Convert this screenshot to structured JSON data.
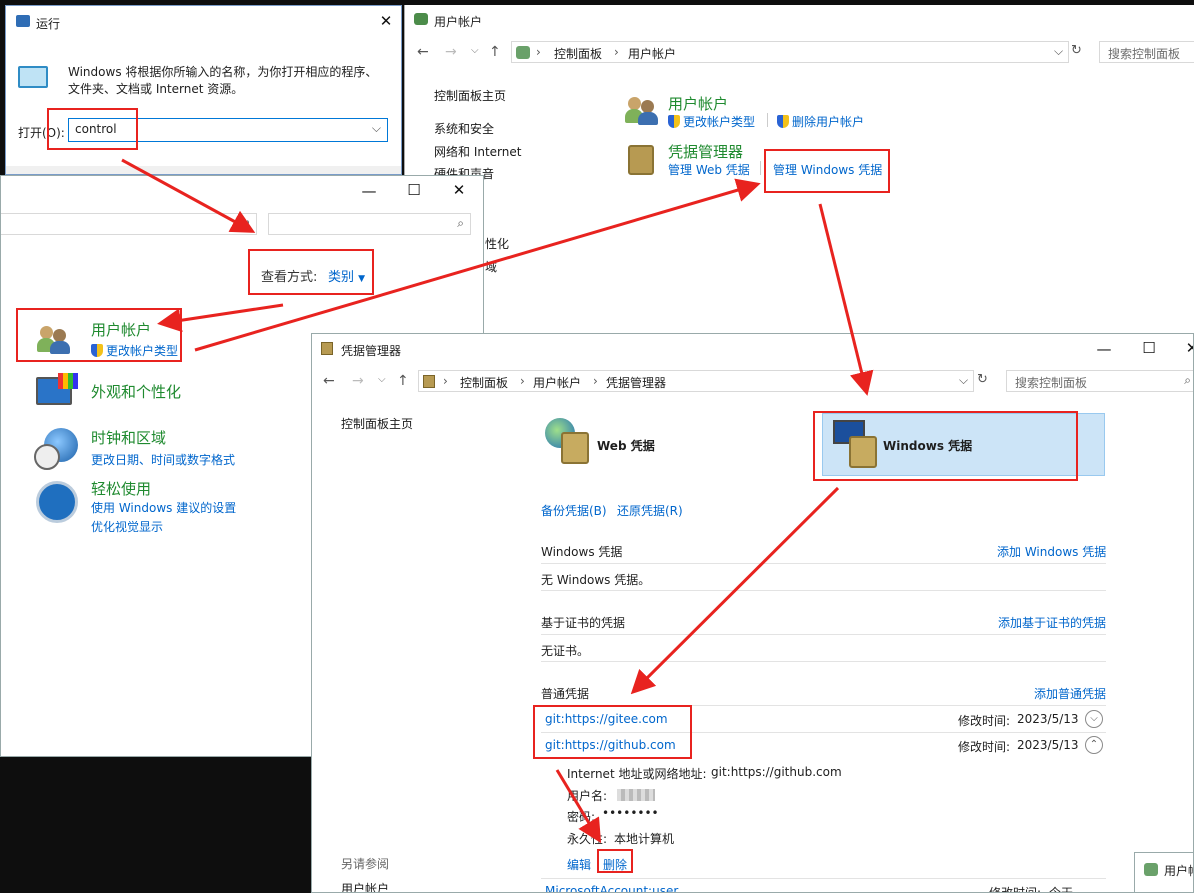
{
  "run": {
    "title": "运行",
    "description": "Windows 将根据你所输入的名称，为你打开相应的程序、文件夹、文档或 Internet 资源。",
    "open_label": "打开(O):",
    "open_value": "control"
  },
  "users": {
    "title": "用户帐户",
    "nav_path": [
      "控制面板",
      "用户帐户"
    ],
    "search_placeholder": "搜索控制面板",
    "sidebar": [
      "控制面板主页",
      "系统和安全",
      "网络和 Internet",
      "硬件和声音",
      "性化",
      "域"
    ],
    "section1_title": "用户帐户",
    "section1_links": [
      "更改帐户类型",
      "删除用户帐户"
    ],
    "section2_title": "凭据管理器",
    "section2_links": [
      "管理 Web 凭据",
      "管理 Windows 凭据"
    ]
  },
  "cp": {
    "view_label": "查看方式:",
    "view_value": "类别",
    "items": [
      {
        "title": "用户帐户",
        "links": [
          "更改帐户类型"
        ]
      },
      {
        "title": "外观和个性化",
        "links": []
      },
      {
        "title": "时钟和区域",
        "links": [
          "更改日期、时间或数字格式"
        ]
      },
      {
        "title": "轻松使用",
        "links": [
          "使用 Windows 建议的设置",
          "优化视觉显示"
        ]
      }
    ]
  },
  "cred": {
    "title": "凭据管理器",
    "nav_path": [
      "控制面板",
      "用户帐户",
      "凭据管理器"
    ],
    "search_placeholder": "搜索控制面板",
    "sidebar_home": "控制面板主页",
    "see_also": "另请参阅",
    "see_also_link": "用户帐户",
    "tiles": [
      "Web 凭据",
      "Windows 凭据"
    ],
    "backup": "备份凭据(B)",
    "restore": "还原凭据(R)",
    "sections": [
      {
        "title": "Windows 凭据",
        "add": "添加 Windows 凭据",
        "empty": "无 Windows 凭据。"
      },
      {
        "title": "基于证书的凭据",
        "add": "添加基于证书的凭据",
        "empty": "无证书。"
      },
      {
        "title": "普通凭据",
        "add": "添加普通凭据"
      }
    ],
    "entries": [
      {
        "name": "git:https://gitee.com",
        "modified_label": "修改时间:",
        "date": "2023/5/13"
      },
      {
        "name": "git:https://github.com",
        "modified_label": "修改时间:",
        "date": "2023/5/13"
      }
    ],
    "detail": {
      "address_label": "Internet 地址或网络地址:",
      "address": "git:https://github.com",
      "user_label": "用户名:",
      "password_label": "密码:",
      "password": "••••••••",
      "persist_label": "永久性:",
      "persist": "本地计算机",
      "edit": "编辑",
      "delete": "删除"
    },
    "last_entry": "MicrosoftAccount:user",
    "last_modified": "修改时间:",
    "last_date": "今天"
  },
  "taskbar_peek": "用户帐"
}
